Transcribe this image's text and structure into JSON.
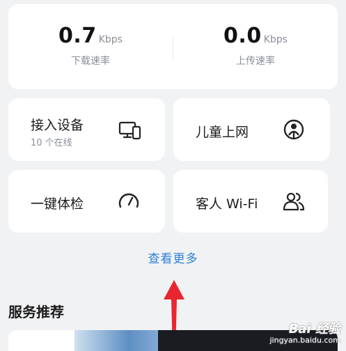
{
  "speed": {
    "download": {
      "value": "0.7",
      "unit": "Kbps",
      "label": "下载速率"
    },
    "upload": {
      "value": "0.0",
      "unit": "Kbps",
      "label": "上传速率"
    }
  },
  "tiles": [
    {
      "title": "接入设备",
      "subtitle": "10 个在线",
      "icon": "devices-icon"
    },
    {
      "title": "儿童上网",
      "icon": "child-icon"
    },
    {
      "title": "一键体检",
      "icon": "gauge-icon"
    },
    {
      "title": "客人 Wi-Fi",
      "icon": "guests-icon"
    }
  ],
  "more_link": "查看更多",
  "section_title": "服务推荐",
  "watermark": {
    "brand": "Bai 经验",
    "domain": "jingyan.baidu.com"
  },
  "colors": {
    "accent": "#2d7fd6",
    "arrow": "#e8262f",
    "background": "#f1f2f4"
  }
}
